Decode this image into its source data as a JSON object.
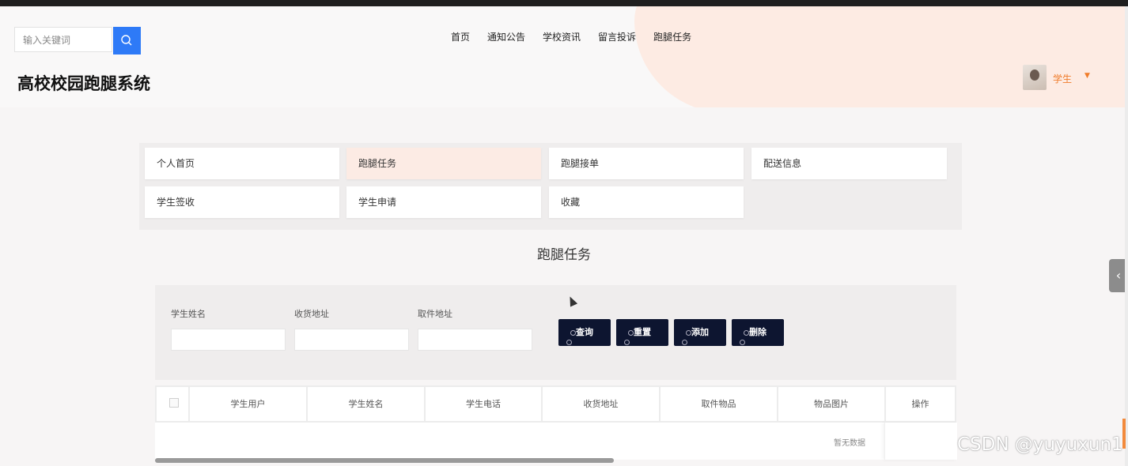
{
  "header": {
    "search_placeholder": "输入关键词",
    "nav": [
      "首页",
      "通知公告",
      "学校资讯",
      "留言投诉",
      "跑腿任务"
    ],
    "site_title": "高校校园跑腿系统",
    "user": {
      "name": "学生"
    }
  },
  "menu": {
    "items": [
      {
        "label": "个人首页"
      },
      {
        "label": "跑腿任务"
      },
      {
        "label": "跑腿接单"
      },
      {
        "label": "配送信息"
      },
      {
        "label": "学生签收"
      },
      {
        "label": "学生申请"
      },
      {
        "label": "收藏"
      }
    ],
    "active": "跑腿任务"
  },
  "section_title": "跑腿任务",
  "filters": {
    "labels": [
      "学生姓名",
      "收货地址",
      "取件地址"
    ],
    "buttons": [
      "查询",
      "重置",
      "添加",
      "删除"
    ]
  },
  "table": {
    "columns": [
      "学生用户",
      "学生姓名",
      "学生电话",
      "收货地址",
      "取件物品",
      "物品图片",
      "操作"
    ],
    "empty_text": "暂无数据"
  },
  "watermark": "CSDN @yuyuxun1",
  "colors": {
    "accent": "#f07c2a",
    "search_button": "#2e7af7",
    "dark_button": "#0d1530"
  }
}
